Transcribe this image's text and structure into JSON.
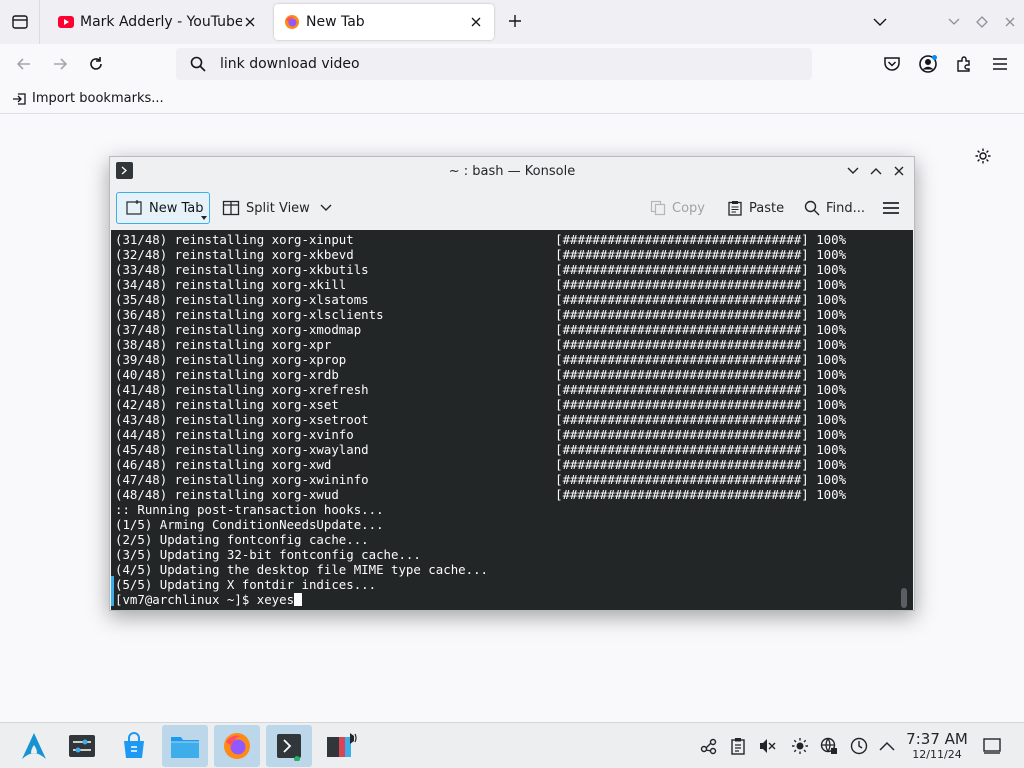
{
  "browser": {
    "tabs": [
      {
        "label": "Mark Adderly - YouTube",
        "favicon": "youtube-icon",
        "active": false
      },
      {
        "label": "New Tab",
        "favicon": "firefox-icon",
        "active": true
      }
    ],
    "url_text": "link download video",
    "bookmarks_toolbar": {
      "import_label": "Import bookmarks..."
    }
  },
  "konsole": {
    "title": "~ : bash — Konsole",
    "toolbar": {
      "new_tab": "New Tab",
      "split_view": "Split View",
      "copy": "Copy",
      "paste": "Paste",
      "find": "Find..."
    },
    "progress_bar": "[################################]",
    "progress_pct": "100%",
    "packages": [
      "(31/48) reinstalling xorg-xinput",
      "(32/48) reinstalling xorg-xkbevd",
      "(33/48) reinstalling xorg-xkbutils",
      "(34/48) reinstalling xorg-xkill",
      "(35/48) reinstalling xorg-xlsatoms",
      "(36/48) reinstalling xorg-xlsclients",
      "(37/48) reinstalling xorg-xmodmap",
      "(38/48) reinstalling xorg-xpr",
      "(39/48) reinstalling xorg-xprop",
      "(40/48) reinstalling xorg-xrdb",
      "(41/48) reinstalling xorg-xrefresh",
      "(42/48) reinstalling xorg-xset",
      "(43/48) reinstalling xorg-xsetroot",
      "(44/48) reinstalling xorg-xvinfo",
      "(45/48) reinstalling xorg-xwayland",
      "(46/48) reinstalling xorg-xwd",
      "(47/48) reinstalling xorg-xwininfo",
      "(48/48) reinstalling xorg-xwud"
    ],
    "hooks": [
      ":: Running post-transaction hooks...",
      "(1/5) Arming ConditionNeedsUpdate...",
      "(2/5) Updating fontconfig cache...",
      "(3/5) Updating 32-bit fontconfig cache...",
      "(4/5) Updating the desktop file MIME type cache...",
      "(5/5) Updating X fontdir indices..."
    ],
    "prompt": "[vm7@archlinux ~]$ ",
    "command": "xeyes"
  },
  "taskbar": {
    "apps": [
      "arch-launcher-icon",
      "system-settings-icon",
      "discover-store-icon",
      "dolphin-files-icon",
      "firefox-icon",
      "konsole-icon",
      "media-app-icon"
    ],
    "clock": {
      "time": "7:37 AM",
      "date": "12/11/24"
    }
  },
  "colors": {
    "accent": "#3daee9",
    "terminal_bg": "#232627",
    "youtube_red": "#ff0033",
    "arch_blue": "#1793d1"
  }
}
